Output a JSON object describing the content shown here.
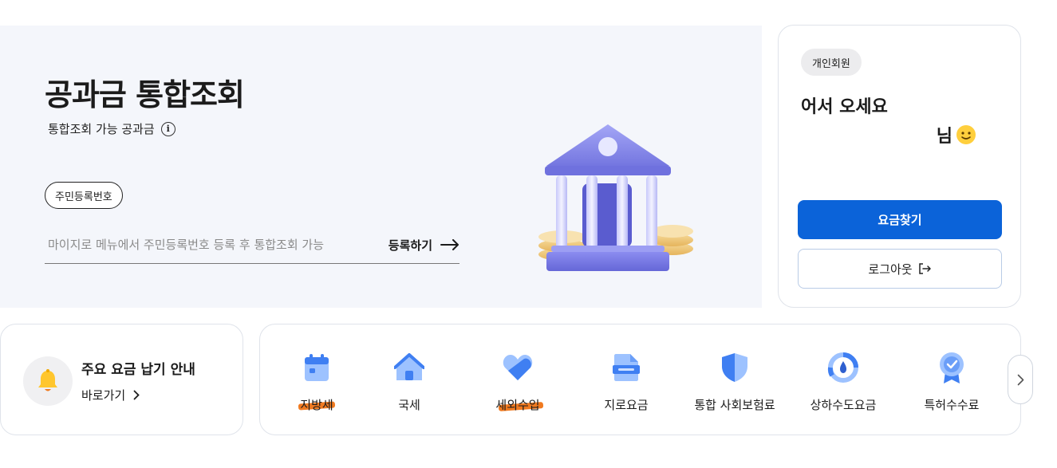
{
  "hero": {
    "title": "공과금 통합조회",
    "subtitle": "통합조회 가능 공과금",
    "info_icon": "i",
    "id_pill": "주민등록번호",
    "id_placeholder": "마이지로 메뉴에서 주민등록번호 등록 후 통합조회 가능",
    "register_label": "등록하기",
    "icon": "bank-building-icon"
  },
  "member": {
    "badge": "개인회원",
    "welcome": "어서 오세요",
    "name_suffix": "님",
    "find_label": "요금찾기",
    "logout_label": "로그아웃",
    "accent": "#0b63d9"
  },
  "guide": {
    "title": "주요 요금 납기 안내",
    "link_label": "바로가기"
  },
  "categories": [
    {
      "label": "지방세",
      "icon": "calendar-icon",
      "marked": true
    },
    {
      "label": "국세",
      "icon": "house-icon",
      "marked": false
    },
    {
      "label": "세외수입",
      "icon": "heart-icon",
      "marked": true
    },
    {
      "label": "지로요금",
      "icon": "document-icon",
      "marked": false
    },
    {
      "label": "통합 사회보험료",
      "icon": "shield-icon",
      "marked": false
    },
    {
      "label": "상하수도요금",
      "icon": "water-gauge-icon",
      "marked": false
    },
    {
      "label": "특허수수료",
      "icon": "medal-icon",
      "marked": false
    }
  ],
  "colors": {
    "primary_blue": "#0b63d9",
    "icon_blue": "#4a86f7",
    "highlight_orange": "#f07a20",
    "bank_purple": "#7f7fe8"
  }
}
